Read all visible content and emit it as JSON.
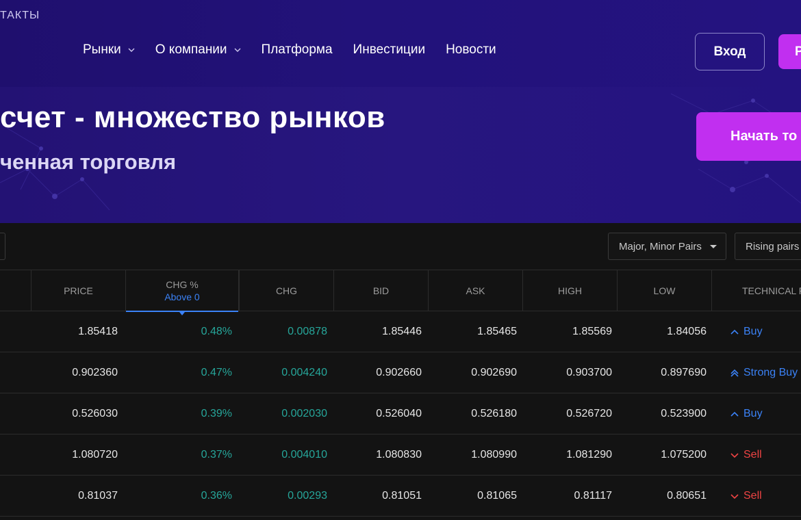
{
  "header": {
    "contacts_label": "ТАКТЫ",
    "nav": [
      {
        "label": "Рынки",
        "dropdown": true
      },
      {
        "label": "О компании",
        "dropdown": true
      },
      {
        "label": "Платформа",
        "dropdown": false
      },
      {
        "label": "Инвестиции",
        "dropdown": false
      },
      {
        "label": "Новости",
        "dropdown": false
      }
    ],
    "login_label": "Вход",
    "register_label": "Р"
  },
  "hero": {
    "title": "счет - множество рынков",
    "subtitle": "ченная торговля",
    "cta_label": "Начать то"
  },
  "filters": {
    "pairs_select": "Major, Minor Pairs",
    "sort_select": "Rising pairs"
  },
  "table": {
    "headers": {
      "price": "PRICE",
      "chg_pct": "CHG %",
      "chg_pct_filter": "Above 0",
      "chg": "CHG",
      "bid": "BID",
      "ask": "ASK",
      "high": "HIGH",
      "low": "LOW",
      "technical": "TECHNICAL R"
    },
    "rows": [
      {
        "price": "1.85418",
        "chg_pct": "0.48%",
        "chg": "0.00878",
        "bid": "1.85446",
        "ask": "1.85465",
        "high": "1.85569",
        "low": "1.84056",
        "rating": "Buy",
        "rating_type": "buy"
      },
      {
        "price": "0.902360",
        "chg_pct": "0.47%",
        "chg": "0.004240",
        "bid": "0.902660",
        "ask": "0.902690",
        "high": "0.903700",
        "low": "0.897690",
        "rating": "Strong Buy",
        "rating_type": "strong-buy"
      },
      {
        "price": "0.526030",
        "chg_pct": "0.39%",
        "chg": "0.002030",
        "bid": "0.526040",
        "ask": "0.526180",
        "high": "0.526720",
        "low": "0.523900",
        "rating": "Buy",
        "rating_type": "buy"
      },
      {
        "price": "1.080720",
        "chg_pct": "0.37%",
        "chg": "0.004010",
        "bid": "1.080830",
        "ask": "1.080990",
        "high": "1.081290",
        "low": "1.075200",
        "rating": "Sell",
        "rating_type": "sell"
      },
      {
        "price": "0.81037",
        "chg_pct": "0.36%",
        "chg": "0.00293",
        "bid": "0.81051",
        "ask": "0.81065",
        "high": "0.81117",
        "low": "0.80651",
        "rating": "Sell",
        "rating_type": "sell"
      }
    ]
  },
  "colors": {
    "header_bg": "#1f0f6e",
    "accent_magenta": "#c12ff0",
    "positive": "#26a69a",
    "buy_blue": "#3b82f6",
    "sell_red": "#ef4444"
  }
}
